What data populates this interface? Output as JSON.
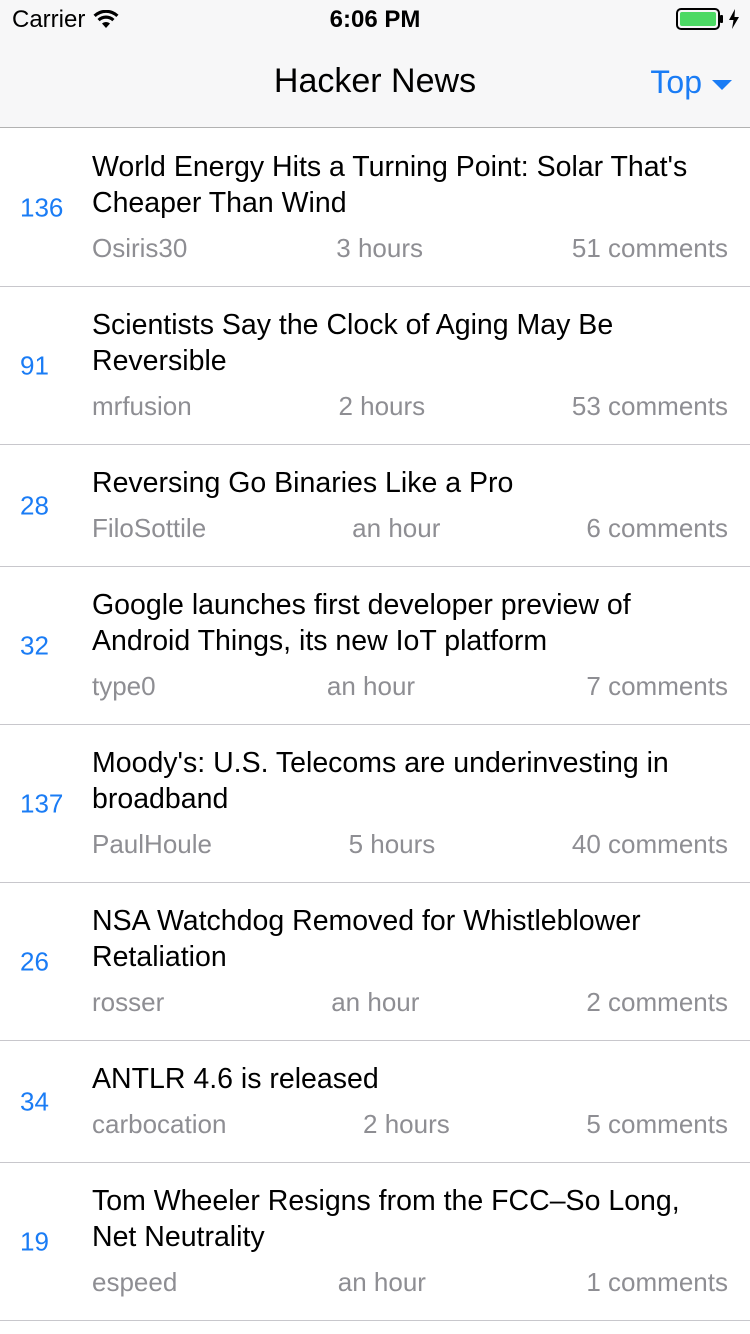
{
  "status_bar": {
    "carrier": "Carrier",
    "time": "6:06 PM",
    "icons": [
      "wifi-icon",
      "battery-icon",
      "charging-bolt-icon"
    ]
  },
  "navbar": {
    "title": "Hacker News",
    "filter_label": "Top",
    "filter_icon": "caret-down-icon",
    "accent_color": "#1a7cf5"
  },
  "stories": [
    {
      "score": "136",
      "title": "World Energy Hits a Turning Point: Solar That's Cheaper Than Wind",
      "author": "Osiris30",
      "age": "3 hours",
      "comments": "51 comments"
    },
    {
      "score": "91",
      "title": "Scientists Say the Clock of Aging May Be Reversible",
      "author": "mrfusion",
      "age": "2 hours",
      "comments": "53 comments"
    },
    {
      "score": "28",
      "title": "Reversing Go Binaries Like a Pro",
      "author": "FiloSottile",
      "age": "an hour",
      "comments": "6 comments"
    },
    {
      "score": "32",
      "title": "Google launches first developer preview of Android Things, its new IoT platform",
      "author": "type0",
      "age": "an hour",
      "comments": "7 comments"
    },
    {
      "score": "137",
      "title": "Moody's: U.S. Telecoms are underinvesting in broadband",
      "author": "PaulHoule",
      "age": "5 hours",
      "comments": "40 comments"
    },
    {
      "score": "26",
      "title": "NSA Watchdog Removed for Whistleblower Retaliation",
      "author": "rosser",
      "age": "an hour",
      "comments": "2 comments"
    },
    {
      "score": "34",
      "title": "ANTLR 4.6 is released",
      "author": "carbocation",
      "age": "2 hours",
      "comments": "5 comments"
    },
    {
      "score": "19",
      "title": "Tom Wheeler Resigns from the FCC–So Long, Net Neutrality",
      "author": "espeed",
      "age": "an hour",
      "comments": "1 comments"
    }
  ]
}
